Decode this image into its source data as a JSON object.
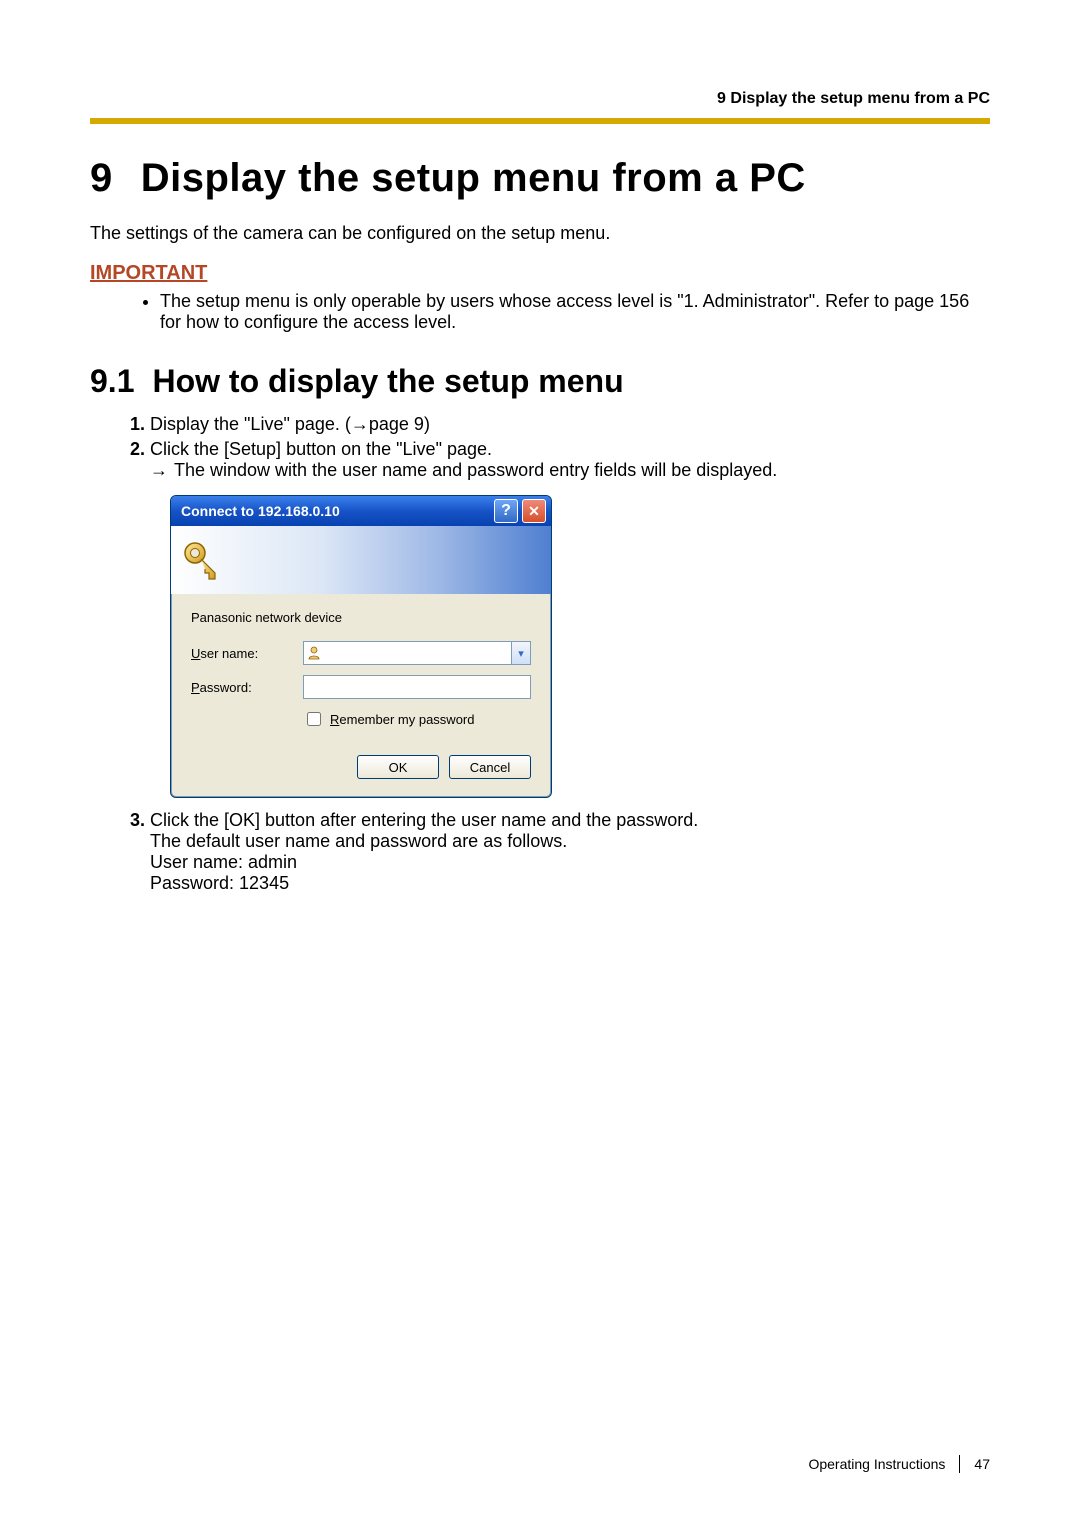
{
  "header": {
    "running_title": "9 Display the setup menu from a PC"
  },
  "chapter": {
    "number": "9",
    "title": "Display the setup menu from a PC"
  },
  "intro": "The settings of the camera can be configured on the setup menu.",
  "important": {
    "label": "IMPORTANT",
    "bullets": [
      "The setup menu is only operable by users whose access level is \"1. Administrator\". Refer to page 156 for how to configure the access level."
    ]
  },
  "section": {
    "number": "9.1",
    "title": "How to display the setup menu"
  },
  "steps": {
    "s1": "Display the \"Live\" page. (→page 9)",
    "s2_main": "Click the [Setup] button on the \"Live\" page.",
    "s2_arrow": "→",
    "s2_sub": "The window with the user name and password entry fields will be displayed.",
    "s3_line1": "Click the [OK] button after entering the user name and the password.",
    "s3_line2": "The default user name and password are as follows.",
    "s3_line3": "User name: admin",
    "s3_line4": "Password: 12345"
  },
  "dialog": {
    "title": "Connect to 192.168.0.10",
    "device_name": "Panasonic network device",
    "username_label_pre": "U",
    "username_label_post": "ser name:",
    "password_label_pre": "P",
    "password_label_post": "assword:",
    "remember_pre": "R",
    "remember_post": "emember my password",
    "ok": "OK",
    "cancel": "Cancel"
  },
  "footer": {
    "doc": "Operating Instructions",
    "page": "47"
  }
}
